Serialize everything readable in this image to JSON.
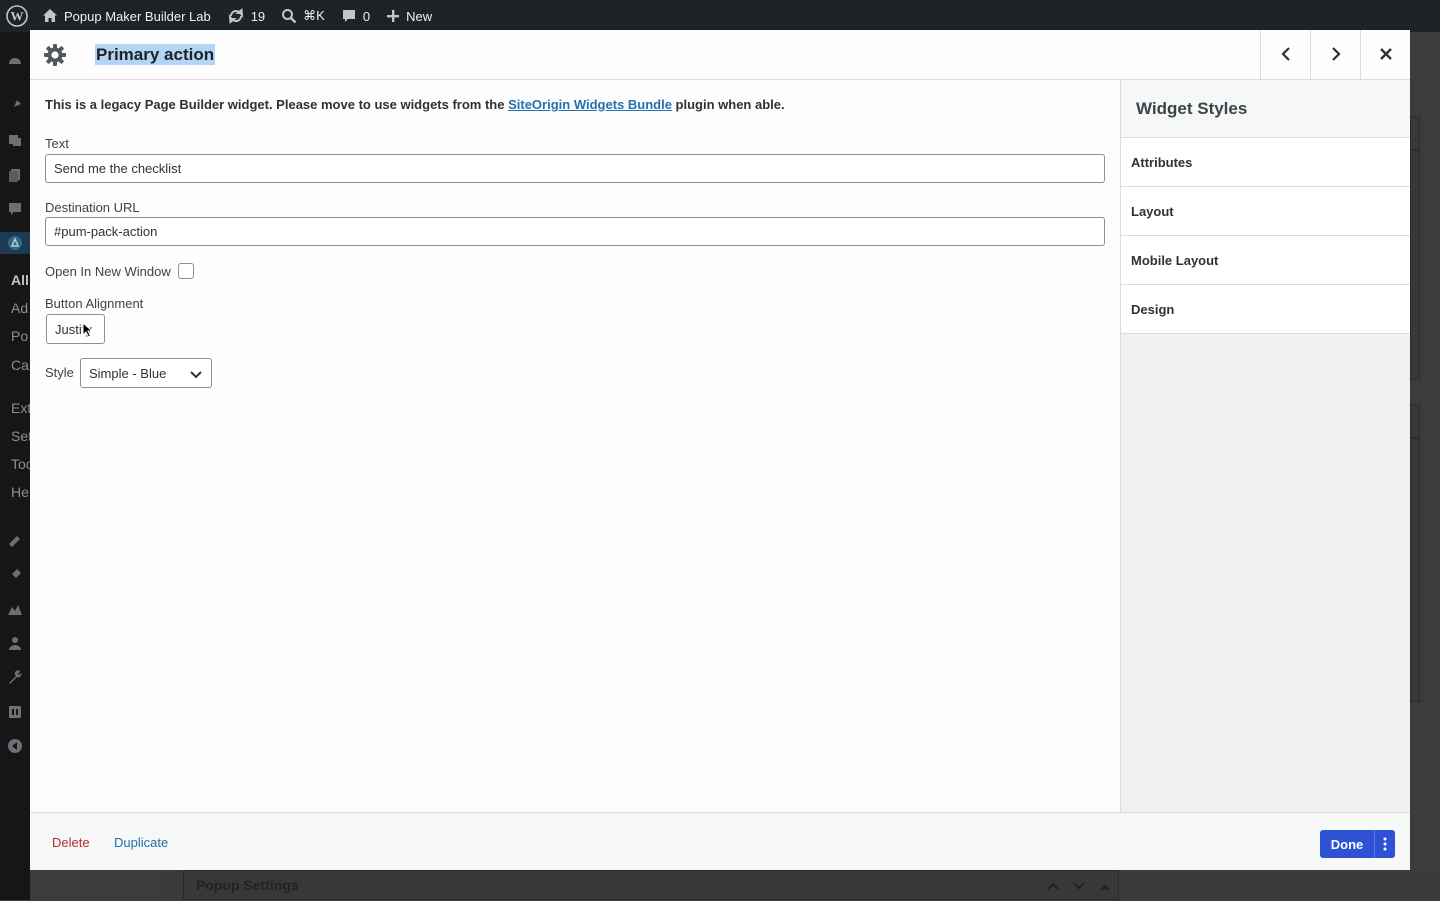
{
  "adminbar": {
    "site_name": "Popup Maker Builder Lab",
    "updates_count": "19",
    "search_shortcut": "⌘K",
    "comments_count": "0",
    "new_label": "New"
  },
  "sidebar": {
    "labels": [
      "All",
      "Ad",
      "Po",
      "Ca",
      "Ext",
      "Set",
      "Too",
      "He"
    ]
  },
  "modal": {
    "title": "Primary action",
    "legacy_note_prefix": "This is a legacy Page Builder widget. Please move to use widgets from the ",
    "legacy_note_link": "SiteOrigin Widgets Bundle",
    "legacy_note_suffix": " plugin when able.",
    "fields": {
      "text_label": "Text",
      "text_value": "Send me the checklist",
      "url_label": "Destination URL",
      "url_value": "#pum-pack-action",
      "new_window_label": "Open In New Window",
      "new_window_checked": false,
      "alignment_label": "Button Alignment",
      "alignment_value": "Justify",
      "style_label": "Style",
      "style_value": "Simple - Blue"
    },
    "side": {
      "title": "Widget Styles",
      "items": [
        "Attributes",
        "Layout",
        "Mobile Layout",
        "Design"
      ]
    },
    "footer": {
      "delete_label": "Delete",
      "duplicate_label": "Duplicate",
      "done_label": "Done"
    }
  },
  "behind": {
    "popup_settings": "Popup Settings"
  },
  "colors": {
    "accent": "#2f51d6",
    "link": "#2271b1",
    "delete": "#b32d2e",
    "title_selection": "#b4d4f5"
  }
}
